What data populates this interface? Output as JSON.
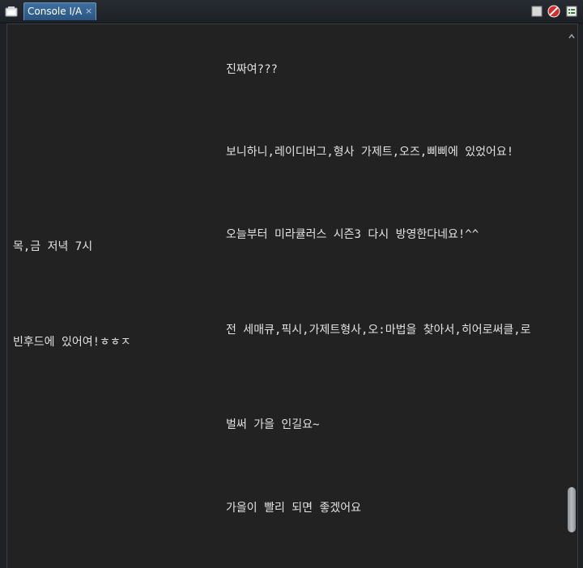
{
  "tab": {
    "label": "Console I/A",
    "close_glyph": "×"
  },
  "toolbar": {
    "icons": [
      "terminal-icon",
      "stop-icon",
      "no-entry-icon",
      "list-view-icon"
    ],
    "colors": {
      "accent": "#2b5480",
      "stop": "#d8d8d8",
      "no_entry": "#d42a2a"
    }
  },
  "console": {
    "lines": [
      {
        "text": "진짜여???"
      },
      {
        "text": "보니하니,레이디버그,형사 가제트,오즈,삐삐에 있었어요!"
      },
      {
        "text": "오늘부터 미라큘러스 시즌3 다시 방영한다네요!^^"
      },
      {
        "text": "목,금 저녁 7시"
      },
      {
        "text": "전 세매큐,픽시,가제트형사,오:마법을 찾아서,히어로써클,로"
      },
      {
        "text": "빈후드에 있어여!ㅎㅎㅈ"
      },
      {
        "text": "벌써 가을 인길요~"
      },
      {
        "text": "가을이 빨리 되면 좋겠어요"
      }
    ]
  }
}
